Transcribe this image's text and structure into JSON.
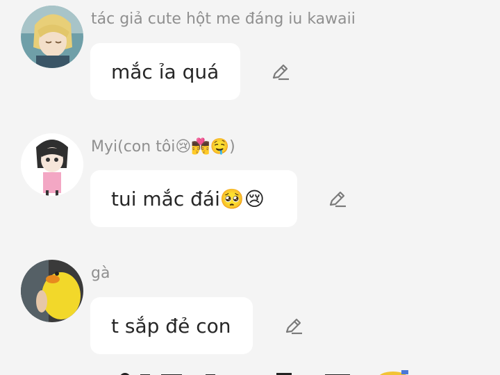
{
  "messages": [
    {
      "author": "tác giả cute hột me đáng iu kawaii",
      "text": "mắc ỉa quá"
    },
    {
      "author": "Myi(con tôi😢👨‍❤️‍💋‍👨🤤)",
      "text": "tui mắc đái🥺😢"
    },
    {
      "author": "gà",
      "text": "t sắp đẻ con"
    }
  ],
  "colors": {
    "background": "#f4f4f4",
    "bubble": "#ffffff",
    "name_text": "#8f8f8f",
    "message_text": "#262626",
    "icon": "#7a7a7a"
  },
  "icons": {
    "edit": "pencil-edit-icon"
  }
}
